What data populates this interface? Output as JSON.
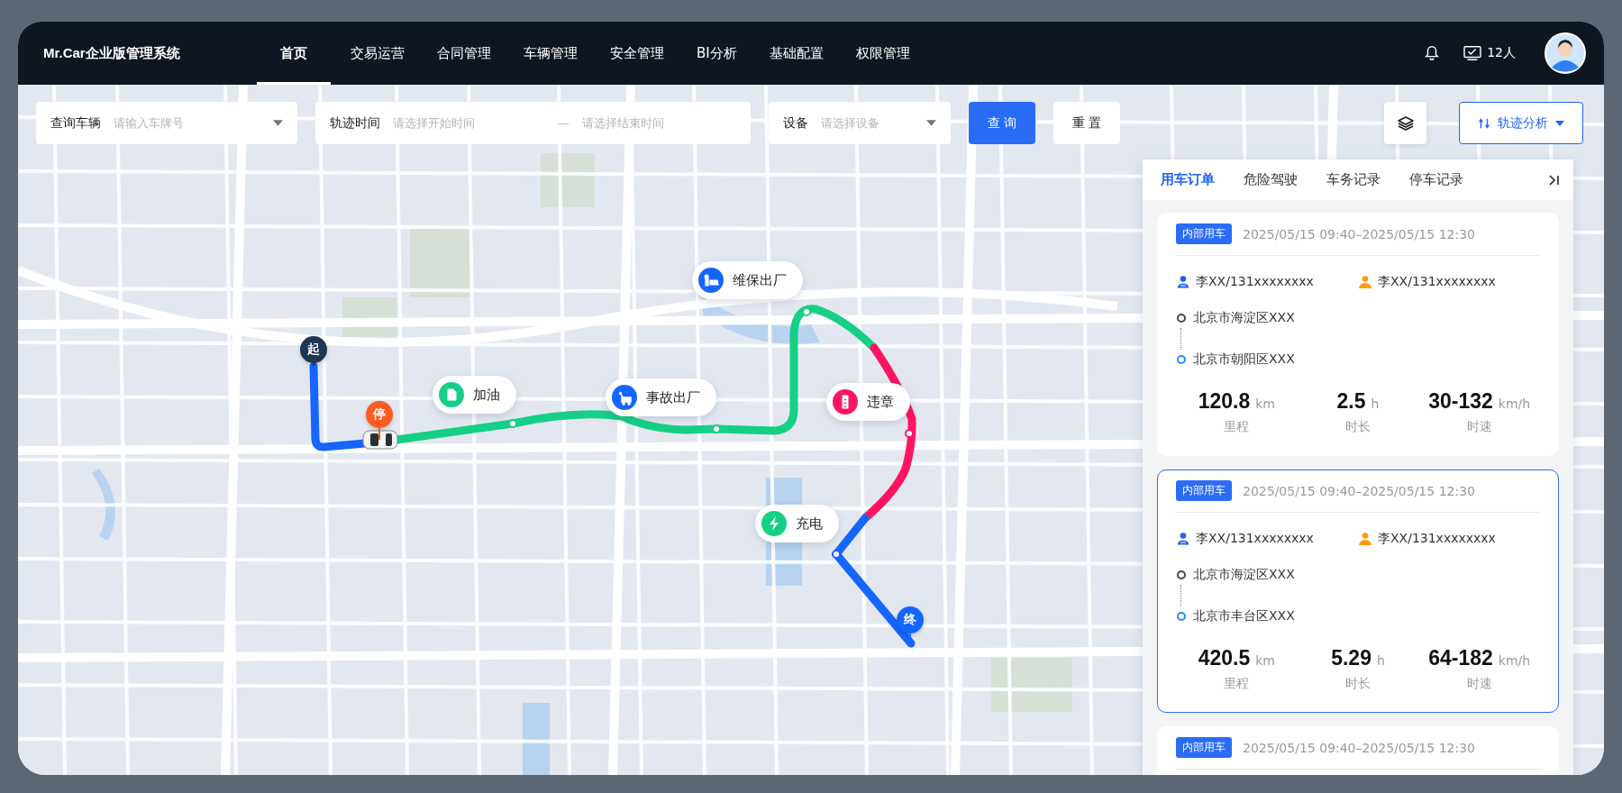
{
  "header": {
    "logo": "Mr.Car企业版管理系统",
    "nav": [
      {
        "label": "首页",
        "selected": true
      },
      {
        "label": "交易运营",
        "selected": false
      },
      {
        "label": "合同管理",
        "selected": false
      },
      {
        "label": "车辆管理",
        "selected": false
      },
      {
        "label": "安全管理",
        "selected": false
      },
      {
        "label": "BI分析",
        "selected": false
      },
      {
        "label": "基础配置",
        "selected": false
      },
      {
        "label": "权限管理",
        "selected": false
      }
    ],
    "user_count": "12人"
  },
  "filters": {
    "vehicle": {
      "label": "查询车辆",
      "placeholder": "请输入车牌号"
    },
    "time": {
      "label": "轨迹时间",
      "start_placeholder": "请选择开始时间",
      "separator": "—",
      "end_placeholder": "请选择结束时间"
    },
    "device": {
      "label": "设备",
      "placeholder": "请选择设备"
    },
    "query_button": "查 询",
    "reset_button": "重 置",
    "analysis_button": "轨迹分析"
  },
  "map": {
    "route_segments": [
      {
        "color": "#1565ff"
      },
      {
        "color": "#16cf86"
      },
      {
        "color": "#ff1463"
      },
      {
        "color": "#1565ff"
      }
    ],
    "markers": [
      {
        "kind": "start",
        "label": "起",
        "color": "#1e3553"
      },
      {
        "kind": "stop",
        "label": "停",
        "color": "#ff5a1f"
      },
      {
        "kind": "end",
        "label": "终",
        "color": "#1565ff"
      }
    ],
    "events": [
      {
        "kind": "fuel",
        "label": "加油",
        "color": "#16cf86"
      },
      {
        "kind": "accident",
        "label": "事故出厂",
        "color": "#1565ff"
      },
      {
        "kind": "maintenance",
        "label": "维保出厂",
        "color": "#1565ff"
      },
      {
        "kind": "violation",
        "label": "违章",
        "color": "#ff1463"
      },
      {
        "kind": "charge",
        "label": "充电",
        "color": "#16cf86"
      }
    ]
  },
  "panel": {
    "tabs": [
      {
        "label": "用车订单",
        "selected": true
      },
      {
        "label": "危险驾驶",
        "selected": false
      },
      {
        "label": "车务记录",
        "selected": false
      },
      {
        "label": "停车记录",
        "selected": false
      }
    ],
    "orders": [
      {
        "tag": "内部用车",
        "time": "2025/05/15 09:40–2025/05/15 12:30",
        "selected": false,
        "driver": "李XX/131xxxxxxxx",
        "passenger": "李XX/131xxxxxxxx",
        "from": "北京市海淀区XXX",
        "to": "北京市朝阳区XXX",
        "stats": [
          {
            "value": "120.8",
            "unit": "km",
            "label": "里程"
          },
          {
            "value": "2.5",
            "unit": "h",
            "label": "时长"
          },
          {
            "value": "30-132",
            "unit": "km/h",
            "label": "时速"
          }
        ]
      },
      {
        "tag": "内部用车",
        "time": "2025/05/15 09:40–2025/05/15 12:30",
        "selected": true,
        "driver": "李XX/131xxxxxxxx",
        "passenger": "李XX/131xxxxxxxx",
        "from": "北京市海淀区XXX",
        "to": "北京市丰台区XXX",
        "stats": [
          {
            "value": "420.5",
            "unit": "km",
            "label": "里程"
          },
          {
            "value": "5.29",
            "unit": "h",
            "label": "时长"
          },
          {
            "value": "64-182",
            "unit": "km/h",
            "label": "时速"
          }
        ]
      },
      {
        "tag": "内部用车",
        "time": "2025/05/15 09:40–2025/05/15 12:30",
        "selected": false
      }
    ]
  }
}
